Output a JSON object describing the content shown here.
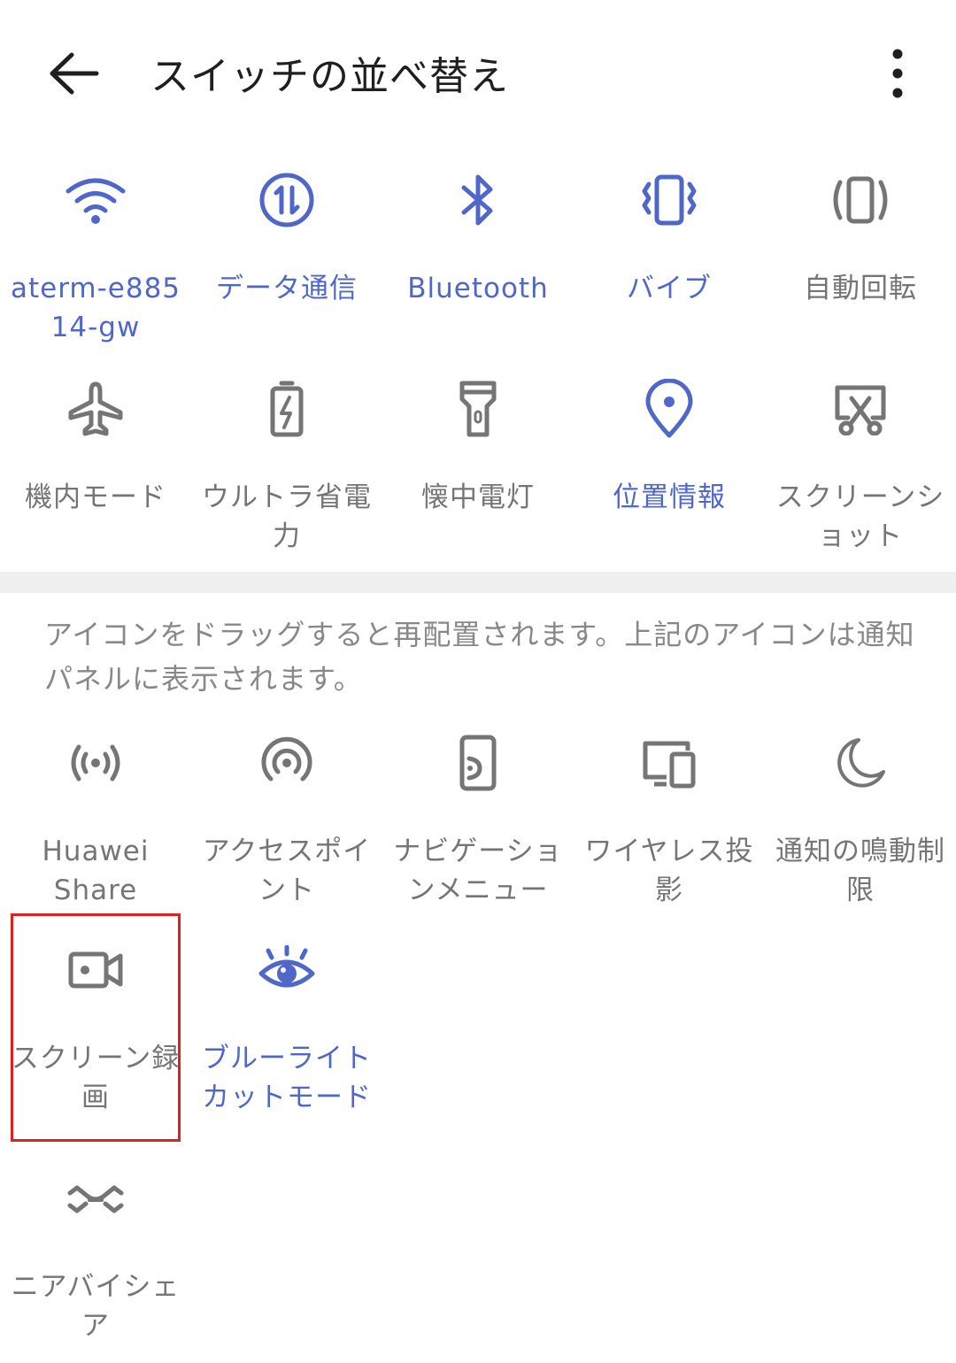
{
  "header": {
    "title": "スイッチの並べ替え",
    "back_icon": "arrow-left-icon",
    "more_icon": "more-vert-icon"
  },
  "colors": {
    "active": "#4f67c9",
    "inactive": "#757575",
    "highlight": "#e02020"
  },
  "active_tiles": [
    {
      "label": "aterm-e88514-gw",
      "icon": "wifi-icon",
      "on": true
    },
    {
      "label": "データ通信",
      "icon": "mobile-data-icon",
      "on": true
    },
    {
      "label": "Bluetooth",
      "icon": "bluetooth-icon",
      "on": true
    },
    {
      "label": "バイブ",
      "icon": "vibrate-icon",
      "on": true
    },
    {
      "label": "自動回転",
      "icon": "auto-rotate-icon",
      "on": false
    },
    {
      "label": "機内モード",
      "icon": "airplane-icon",
      "on": false
    },
    {
      "label": "ウルトラ省電力",
      "icon": "battery-saver-icon",
      "on": false
    },
    {
      "label": "懐中電灯",
      "icon": "flashlight-icon",
      "on": false
    },
    {
      "label": "位置情報",
      "icon": "location-icon",
      "on": true
    },
    {
      "label": "スクリーンショット",
      "icon": "screenshot-icon",
      "on": false
    }
  ],
  "hint_text": "アイコンをドラッグすると再配置されます。上記のアイコンは通知パネルに表示されます。",
  "inactive_tiles": [
    {
      "label": "Huawei Share",
      "icon": "huawei-share-icon",
      "on": false
    },
    {
      "label": "アクセスポイント",
      "icon": "hotspot-icon",
      "on": false
    },
    {
      "label": "ナビゲーションメニュー",
      "icon": "navigation-menu-icon",
      "on": false
    },
    {
      "label": "ワイヤレス投影",
      "icon": "wireless-projection-icon",
      "on": false
    },
    {
      "label": "通知の鳴動制限",
      "icon": "do-not-disturb-icon",
      "on": false
    },
    {
      "label": "スクリーン録画",
      "icon": "screen-record-icon",
      "on": false
    },
    {
      "label": "ブルーライトカットモード",
      "icon": "eye-comfort-icon",
      "on": true
    },
    {
      "label": "ニアバイシェア",
      "icon": "nearby-share-icon",
      "on": false
    }
  ]
}
